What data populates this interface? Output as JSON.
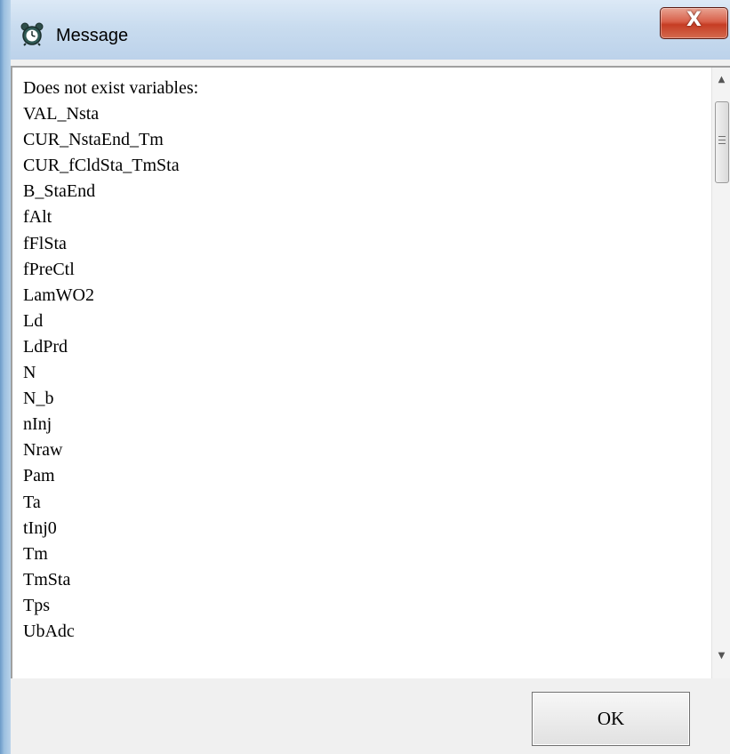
{
  "window": {
    "title": "Message",
    "icon": "alarm-clock-icon",
    "close_label": "X"
  },
  "message": {
    "lines": [
      "Does not exist variables:",
      "VAL_Nsta",
      "CUR_NstaEnd_Tm",
      "CUR_fCldSta_TmSta",
      "B_StaEnd",
      "fAlt",
      "fFlSta",
      "fPreCtl",
      "LamWO2",
      "Ld",
      "LdPrd",
      "N",
      "N_b",
      "nInj",
      "Nraw",
      "Pam",
      "Ta",
      "tInj0",
      "Tm",
      "TmSta",
      "Tps",
      "UbAdc"
    ]
  },
  "scrollbar": {
    "up_arrow": "▲",
    "down_arrow": "▼"
  },
  "buttons": {
    "ok_label": "OK"
  }
}
